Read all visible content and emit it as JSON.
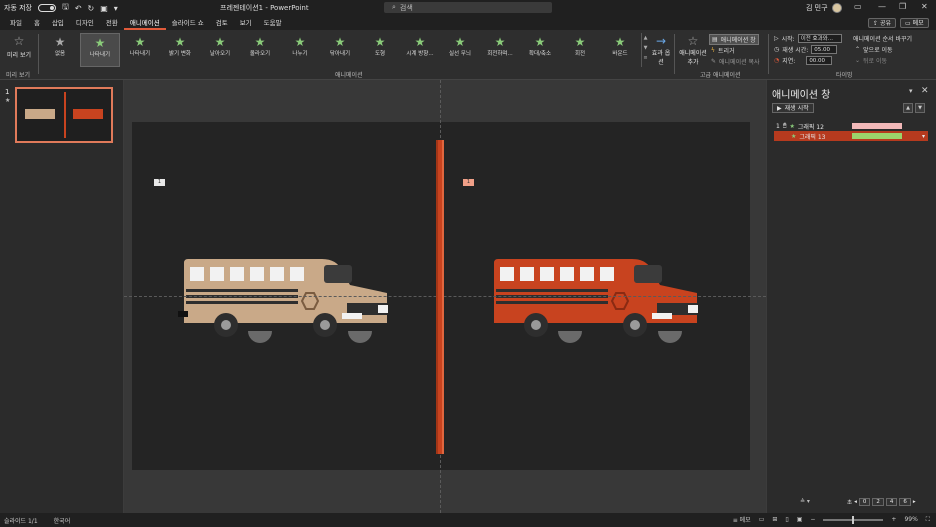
{
  "titlebar": {
    "autosave_label": "자동 저장",
    "doc_title": "프레젠테이션1 - PowerPoint",
    "search_placeholder": "검색",
    "user_name": "김 민구"
  },
  "tabs": [
    "파일",
    "홈",
    "삽입",
    "디자인",
    "전환",
    "애니메이션",
    "슬라이드 쇼",
    "검토",
    "보기",
    "도움말"
  ],
  "active_tab": "애니메이션",
  "share_label": "공유",
  "memo_label": "메모",
  "ribbon": {
    "preview_label": "미리 보기",
    "preview_group": "미리 보기",
    "animations": [
      {
        "label": "없음",
        "icon": "star-gray"
      },
      {
        "label": "나타내기",
        "icon": "star-green"
      },
      {
        "label": "나타내기",
        "icon": "star-green"
      },
      {
        "label": "밝기 변화",
        "icon": "star-green"
      },
      {
        "label": "날아오기",
        "icon": "star-green"
      },
      {
        "label": "올라오기",
        "icon": "star-green"
      },
      {
        "label": "나누기",
        "icon": "star-green"
      },
      {
        "label": "닦아내기",
        "icon": "star-green"
      },
      {
        "label": "도형",
        "icon": "star-green"
      },
      {
        "label": "시계 방향...",
        "icon": "star-green"
      },
      {
        "label": "실선 무늬",
        "icon": "star-green"
      },
      {
        "label": "회전하며...",
        "icon": "star-green"
      },
      {
        "label": "확대/축소",
        "icon": "star-green"
      },
      {
        "label": "회전",
        "icon": "star-green"
      },
      {
        "label": "바운드",
        "icon": "star-green"
      }
    ],
    "animation_group": "애니메이션",
    "effect_options": "효과 옵션",
    "add_animation": "애니메이션 추가",
    "animation_pane": "애니메이션 창",
    "trigger": "트리거",
    "animation_painter": "애니메이션 복사",
    "advanced_group": "고급 애니메이션",
    "start_label": "시작:",
    "start_value": "이전 효과와...",
    "duration_label": "재생 시간:",
    "duration_value": "05.00",
    "delay_label": "지연:",
    "delay_value": "00.00",
    "reorder_label": "애니메이션 순서 바꾸기",
    "move_earlier": "앞으로 이동",
    "move_later": "뒤로 이동",
    "timing_group": "타이밍"
  },
  "slides_pane": {
    "slide_number": "1",
    "star": "★"
  },
  "slide": {
    "tag1": "1",
    "tag2": "1"
  },
  "anim_pane": {
    "title": "애니메이션 창",
    "play_label": "재생 시작",
    "items": [
      {
        "index": "1",
        "name": "그래픽 12",
        "bar_color": "#f2b8b8"
      },
      {
        "index": "",
        "name": "그래픽 13",
        "bar_color": "#9bd36b"
      }
    ],
    "seconds_label": "초",
    "pager": [
      "0",
      "2",
      "4",
      "6"
    ]
  },
  "statusbar": {
    "slide_info": "슬라이드 1/1",
    "language": "한국어",
    "notes": "메모",
    "zoom": "99%"
  }
}
